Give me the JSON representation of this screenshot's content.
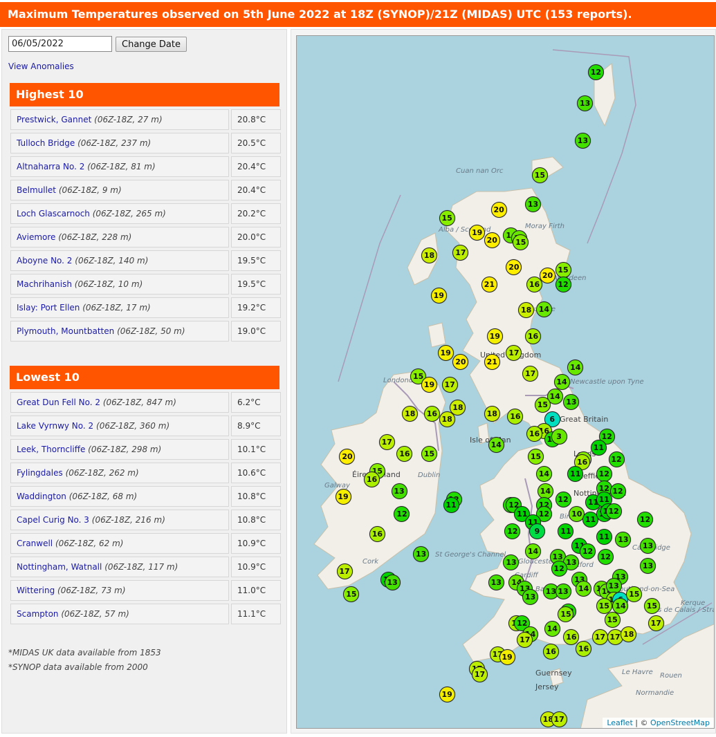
{
  "title": "Maximum Temperatures observed on 5th June 2022 at 18Z (SYNOP)/21Z (MIDAS) UTC (153 reports).",
  "controls": {
    "date_value": "06/05/2022",
    "change_label": "Change Date",
    "anomalies_label": "View Anomalies"
  },
  "highest": {
    "heading": "Highest 10",
    "rows": [
      {
        "name": "Prestwick, Gannet",
        "meta": "(06Z-18Z, 27 m)",
        "value": "20.8°C"
      },
      {
        "name": "Tulloch Bridge",
        "meta": "(06Z-18Z, 237 m)",
        "value": "20.5°C"
      },
      {
        "name": "Altnaharra No. 2",
        "meta": "(06Z-18Z, 81 m)",
        "value": "20.4°C"
      },
      {
        "name": "Belmullet",
        "meta": "(06Z-18Z, 9 m)",
        "value": "20.4°C"
      },
      {
        "name": "Loch Glascarnoch",
        "meta": "(06Z-18Z, 265 m)",
        "value": "20.2°C"
      },
      {
        "name": "Aviemore",
        "meta": "(06Z-18Z, 228 m)",
        "value": "20.0°C"
      },
      {
        "name": "Aboyne No. 2",
        "meta": "(06Z-18Z, 140 m)",
        "value": "19.5°C"
      },
      {
        "name": "Machrihanish",
        "meta": "(06Z-18Z, 10 m)",
        "value": "19.5°C"
      },
      {
        "name": "Islay: Port Ellen",
        "meta": "(06Z-18Z, 17 m)",
        "value": "19.2°C"
      },
      {
        "name": "Plymouth, Mountbatten",
        "meta": "(06Z-18Z, 50 m)",
        "value": "19.0°C"
      }
    ]
  },
  "lowest": {
    "heading": "Lowest 10",
    "rows": [
      {
        "name": "Great Dun Fell No. 2",
        "meta": "(06Z-18Z, 847 m)",
        "value": "6.2°C"
      },
      {
        "name": "Lake Vyrnwy No. 2",
        "meta": "(06Z-18Z, 360 m)",
        "value": "8.9°C"
      },
      {
        "name": "Leek, Thorncliffe",
        "meta": "(06Z-18Z, 298 m)",
        "value": "10.1°C"
      },
      {
        "name": "Fylingdales",
        "meta": "(06Z-18Z, 262 m)",
        "value": "10.6°C"
      },
      {
        "name": "Waddington",
        "meta": "(06Z-18Z, 68 m)",
        "value": "10.8°C"
      },
      {
        "name": "Capel Curig No. 3",
        "meta": "(06Z-18Z, 216 m)",
        "value": "10.8°C"
      },
      {
        "name": "Cranwell",
        "meta": "(06Z-18Z, 62 m)",
        "value": "10.9°C"
      },
      {
        "name": "Nottingham, Watnall",
        "meta": "(06Z-18Z, 117 m)",
        "value": "10.9°C"
      },
      {
        "name": "Wittering",
        "meta": "(06Z-18Z, 73 m)",
        "value": "11.0°C"
      },
      {
        "name": "Scampton",
        "meta": "(06Z-18Z, 57 m)",
        "value": "11.1°C"
      }
    ]
  },
  "notes": [
    "*MIDAS UK data available from 1853",
    "*SYNOP data available from 2000"
  ],
  "map": {
    "colors": {
      "sea": "#aad3df",
      "land": "#f2efe9",
      "border": "#a99ab7"
    },
    "place_labels": [
      "United Kingdom",
      "Great Britain",
      "Éire / Ireland",
      "Isle of Man",
      "Newcastle upon Tyne",
      "Leeds",
      "Sheffield",
      "Hull",
      "Nottingham",
      "Birmingham",
      "Gloucester",
      "Cardiff",
      "Bath",
      "Oxford",
      "London",
      "Cambridge",
      "Southend-on-Sea",
      "Dundee",
      "Aberdeen",
      "Galway",
      "Dublin",
      "Cork",
      "Londonderry",
      "Guernsey",
      "Jersey",
      "Le Havre",
      "Rouen",
      "Normandie",
      "Pas de Calais / Strait of Dover",
      "Cuan nan Orc",
      "Moray Firth",
      "Alba / Scotland",
      "St George's Channel",
      "Kerque"
    ],
    "attribution": {
      "leaflet": "Leaflet",
      "sep": " | © ",
      "osm": "OpenStreetMap"
    },
    "color_scale": {
      "6": "#00e0c0",
      "9": "#00dd44",
      "11": "#00d400",
      "12": "#22dd00",
      "13": "#44e000",
      "14": "#66e800",
      "15": "#88ee00",
      "16": "#aaee00",
      "17": "#bbee00",
      "18": "#ccee00",
      "19": "#f4ee00",
      "20": "#ffee00",
      "21": "#ffee00"
    },
    "stations": [
      {
        "t": "12",
        "lon": -0.85,
        "lat": 60.75
      },
      {
        "t": "13",
        "lon": -1.25,
        "lat": 60.2
      },
      {
        "t": "13",
        "lon": -1.33,
        "lat": 59.55
      },
      {
        "t": "15",
        "lon": -2.9,
        "lat": 58.95
      },
      {
        "t": "13",
        "lon": -3.15,
        "lat": 58.45
      },
      {
        "t": "20",
        "lon": -4.4,
        "lat": 58.35
      },
      {
        "t": "15",
        "lon": -6.3,
        "lat": 58.2
      },
      {
        "t": "19",
        "lon": -5.2,
        "lat": 57.95
      },
      {
        "t": "20",
        "lon": -4.65,
        "lat": 57.82
      },
      {
        "t": "14",
        "lon": -3.95,
        "lat": 57.9
      },
      {
        "t": "14",
        "lon": -3.65,
        "lat": 57.85
      },
      {
        "t": "15",
        "lon": -3.6,
        "lat": 57.78
      },
      {
        "t": "18",
        "lon": -6.95,
        "lat": 57.55
      },
      {
        "t": "17",
        "lon": -5.8,
        "lat": 57.6
      },
      {
        "t": "20",
        "lon": -3.85,
        "lat": 57.35
      },
      {
        "t": "15",
        "lon": -2.05,
        "lat": 57.3
      },
      {
        "t": "20",
        "lon": -2.62,
        "lat": 57.2
      },
      {
        "t": "21",
        "lon": -4.75,
        "lat": 57.05
      },
      {
        "t": "16",
        "lon": -3.1,
        "lat": 57.05
      },
      {
        "t": "12",
        "lon": -2.05,
        "lat": 57.05
      },
      {
        "t": "19",
        "lon": -6.6,
        "lat": 56.85
      },
      {
        "t": "18",
        "lon": -3.4,
        "lat": 56.6
      },
      {
        "t": "14",
        "lon": -2.75,
        "lat": 56.62
      },
      {
        "t": "19",
        "lon": -4.55,
        "lat": 56.15
      },
      {
        "t": "16",
        "lon": -3.15,
        "lat": 56.15
      },
      {
        "t": "19",
        "lon": -6.35,
        "lat": 55.85
      },
      {
        "t": "17",
        "lon": -3.85,
        "lat": 55.85
      },
      {
        "t": "20",
        "lon": -5.8,
        "lat": 55.7
      },
      {
        "t": "21",
        "lon": -4.65,
        "lat": 55.7
      },
      {
        "t": "15",
        "lon": -7.35,
        "lat": 55.45
      },
      {
        "t": "14",
        "lon": -1.6,
        "lat": 55.6
      },
      {
        "t": "17",
        "lon": -3.25,
        "lat": 55.5
      },
      {
        "t": "19",
        "lon": -6.95,
        "lat": 55.3
      },
      {
        "t": "17",
        "lon": -6.2,
        "lat": 55.3
      },
      {
        "t": "14",
        "lon": -2.1,
        "lat": 55.35
      },
      {
        "t": "14",
        "lon": -2.35,
        "lat": 55.1
      },
      {
        "t": "13",
        "lon": -1.75,
        "lat": 55.0
      },
      {
        "t": "15",
        "lon": -2.8,
        "lat": 54.95
      },
      {
        "t": "18",
        "lon": -5.9,
        "lat": 54.9
      },
      {
        "t": "18",
        "lon": -4.65,
        "lat": 54.8
      },
      {
        "t": "18",
        "lon": -7.65,
        "lat": 54.8
      },
      {
        "t": "16",
        "lon": -6.85,
        "lat": 54.8
      },
      {
        "t": "18",
        "lon": -6.3,
        "lat": 54.7
      },
      {
        "t": "16",
        "lon": -3.8,
        "lat": 54.75
      },
      {
        "t": "6",
        "lon": -2.45,
        "lat": 54.7
      },
      {
        "t": "16",
        "lon": -2.75,
        "lat": 54.5
      },
      {
        "t": "16",
        "lon": -3.1,
        "lat": 54.45
      },
      {
        "t": "12",
        "lon": -2.45,
        "lat": 54.35
      },
      {
        "t": "3",
        "lon": -2.2,
        "lat": 54.4
      },
      {
        "t": "12",
        "lon": -0.45,
        "lat": 54.4
      },
      {
        "t": "17",
        "lon": -8.5,
        "lat": 54.3
      },
      {
        "t": "16",
        "lon": -7.85,
        "lat": 54.1
      },
      {
        "t": "11",
        "lon": -0.75,
        "lat": 54.2
      },
      {
        "t": "15",
        "lon": -1.3,
        "lat": 54.0
      },
      {
        "t": "16",
        "lon": -1.35,
        "lat": 53.95
      },
      {
        "t": "15",
        "lon": -6.95,
        "lat": 54.1
      },
      {
        "t": "14",
        "lon": -4.5,
        "lat": 54.25
      },
      {
        "t": "15",
        "lon": -3.05,
        "lat": 54.05
      },
      {
        "t": "12",
        "lon": -0.1,
        "lat": 54.0
      },
      {
        "t": "20",
        "lon": -9.95,
        "lat": 54.05
      },
      {
        "t": "15",
        "lon": -8.85,
        "lat": 53.8
      },
      {
        "t": "16",
        "lon": -9.05,
        "lat": 53.65
      },
      {
        "t": "14",
        "lon": -2.75,
        "lat": 53.75
      },
      {
        "t": "11",
        "lon": -1.6,
        "lat": 53.75
      },
      {
        "t": "12",
        "lon": -0.55,
        "lat": 53.75
      },
      {
        "t": "12",
        "lon": -0.55,
        "lat": 53.5
      },
      {
        "t": "13",
        "lon": -8.05,
        "lat": 53.45
      },
      {
        "t": "14",
        "lon": -2.7,
        "lat": 53.45
      },
      {
        "t": "12",
        "lon": -0.05,
        "lat": 53.45
      },
      {
        "t": "12",
        "lon": -6.05,
        "lat": 53.3
      },
      {
        "t": "11",
        "lon": -6.15,
        "lat": 53.2
      },
      {
        "t": "19",
        "lon": -10.1,
        "lat": 53.35
      },
      {
        "t": "12",
        "lon": -3.95,
        "lat": 53.2
      },
      {
        "t": "12",
        "lon": -3.85,
        "lat": 53.2
      },
      {
        "t": "12",
        "lon": -2.75,
        "lat": 53.2
      },
      {
        "t": "12",
        "lon": -2.05,
        "lat": 53.3
      },
      {
        "t": "11",
        "lon": -0.95,
        "lat": 53.25
      },
      {
        "t": "11",
        "lon": -0.55,
        "lat": 53.3
      },
      {
        "t": "11",
        "lon": -3.55,
        "lat": 53.05
      },
      {
        "t": "12",
        "lon": -2.75,
        "lat": 53.05
      },
      {
        "t": "10",
        "lon": -1.55,
        "lat": 53.05
      },
      {
        "t": "11",
        "lon": -1.05,
        "lat": 52.95
      },
      {
        "t": "11",
        "lon": -0.55,
        "lat": 53.05
      },
      {
        "t": "11",
        "lon": -0.4,
        "lat": 53.1
      },
      {
        "t": "12",
        "lon": -0.2,
        "lat": 53.1
      },
      {
        "t": "12",
        "lon": 0.95,
        "lat": 52.95
      },
      {
        "t": "12",
        "lon": -7.95,
        "lat": 53.05
      },
      {
        "t": "11",
        "lon": -3.15,
        "lat": 52.9
      },
      {
        "t": "9",
        "lon": -3.0,
        "lat": 52.75
      },
      {
        "t": "12",
        "lon": -3.9,
        "lat": 52.75
      },
      {
        "t": "11",
        "lon": -1.95,
        "lat": 52.75
      },
      {
        "t": "11",
        "lon": -0.55,
        "lat": 52.65
      },
      {
        "t": "13",
        "lon": 0.15,
        "lat": 52.6
      },
      {
        "t": "16",
        "lon": -8.85,
        "lat": 52.7
      },
      {
        "t": "13",
        "lon": 1.05,
        "lat": 52.5
      },
      {
        "t": "14",
        "lon": -3.15,
        "lat": 52.4
      },
      {
        "t": "11",
        "lon": -1.45,
        "lat": 52.5
      },
      {
        "t": "12",
        "lon": -1.15,
        "lat": 52.4
      },
      {
        "t": "13",
        "lon": -7.25,
        "lat": 52.35
      },
      {
        "t": "13",
        "lon": -2.25,
        "lat": 52.3
      },
      {
        "t": "12",
        "lon": -0.5,
        "lat": 52.3
      },
      {
        "t": "13",
        "lon": -1.75,
        "lat": 52.2
      },
      {
        "t": "13",
        "lon": 1.05,
        "lat": 52.15
      },
      {
        "t": "17",
        "lon": -10.05,
        "lat": 52.05
      },
      {
        "t": "13",
        "lon": -3.95,
        "lat": 52.2
      },
      {
        "t": "12",
        "lon": -2.2,
        "lat": 52.1
      },
      {
        "t": "13",
        "lon": 0.05,
        "lat": 51.95
      },
      {
        "t": "11",
        "lon": -8.45,
        "lat": 51.9
      },
      {
        "t": "13",
        "lon": -8.3,
        "lat": 51.85
      },
      {
        "t": "15",
        "lon": -9.8,
        "lat": 51.65
      },
      {
        "t": "13",
        "lon": -4.5,
        "lat": 51.85
      },
      {
        "t": "14",
        "lon": -3.75,
        "lat": 51.85
      },
      {
        "t": "13",
        "lon": -3.45,
        "lat": 51.75
      },
      {
        "t": "13",
        "lon": -1.45,
        "lat": 51.9
      },
      {
        "t": "14",
        "lon": -1.3,
        "lat": 51.75
      },
      {
        "t": "13",
        "lon": -2.5,
        "lat": 51.7
      },
      {
        "t": "13",
        "lon": -2.05,
        "lat": 51.7
      },
      {
        "t": "14",
        "lon": -0.65,
        "lat": 51.75
      },
      {
        "t": "14",
        "lon": -0.45,
        "lat": 51.7
      },
      {
        "t": "13",
        "lon": -0.2,
        "lat": 51.8
      },
      {
        "t": "15",
        "lon": -0.2,
        "lat": 51.55
      },
      {
        "t": "6",
        "lon": 0.05,
        "lat": 51.55
      },
      {
        "t": "15",
        "lon": 0.55,
        "lat": 51.65
      },
      {
        "t": "15",
        "lon": 1.2,
        "lat": 51.45
      },
      {
        "t": "13",
        "lon": -3.25,
        "lat": 51.6
      },
      {
        "t": "14",
        "lon": 0.05,
        "lat": 51.45
      },
      {
        "t": "15",
        "lon": -0.55,
        "lat": 51.45
      },
      {
        "t": "12",
        "lon": -1.85,
        "lat": 51.35
      },
      {
        "t": "15",
        "lon": -1.95,
        "lat": 51.3
      },
      {
        "t": "16",
        "lon": -3.75,
        "lat": 51.15
      },
      {
        "t": "12",
        "lon": -3.55,
        "lat": 51.15
      },
      {
        "t": "14",
        "lon": -2.45,
        "lat": 51.05
      },
      {
        "t": "15",
        "lon": -0.25,
        "lat": 51.2
      },
      {
        "t": "17",
        "lon": 1.35,
        "lat": 51.15
      },
      {
        "t": "14",
        "lon": -3.25,
        "lat": 50.95
      },
      {
        "t": "16",
        "lon": -1.75,
        "lat": 50.9
      },
      {
        "t": "17",
        "lon": -0.7,
        "lat": 50.9
      },
      {
        "t": "17",
        "lon": -0.15,
        "lat": 50.9
      },
      {
        "t": "18",
        "lon": 0.35,
        "lat": 50.95
      },
      {
        "t": "17",
        "lon": -3.45,
        "lat": 50.85
      },
      {
        "t": "16",
        "lon": -2.5,
        "lat": 50.65
      },
      {
        "t": "16",
        "lon": -1.3,
        "lat": 50.7
      },
      {
        "t": "17",
        "lon": -4.45,
        "lat": 50.6
      },
      {
        "t": "19",
        "lon": -4.1,
        "lat": 50.55
      },
      {
        "t": "17",
        "lon": -5.2,
        "lat": 50.35
      },
      {
        "t": "17",
        "lon": -5.1,
        "lat": 50.25
      },
      {
        "t": "19",
        "lon": -6.3,
        "lat": 49.9
      },
      {
        "t": "18",
        "lon": -2.6,
        "lat": 49.45
      },
      {
        "t": "17",
        "lon": -2.2,
        "lat": 49.2
      }
    ]
  }
}
